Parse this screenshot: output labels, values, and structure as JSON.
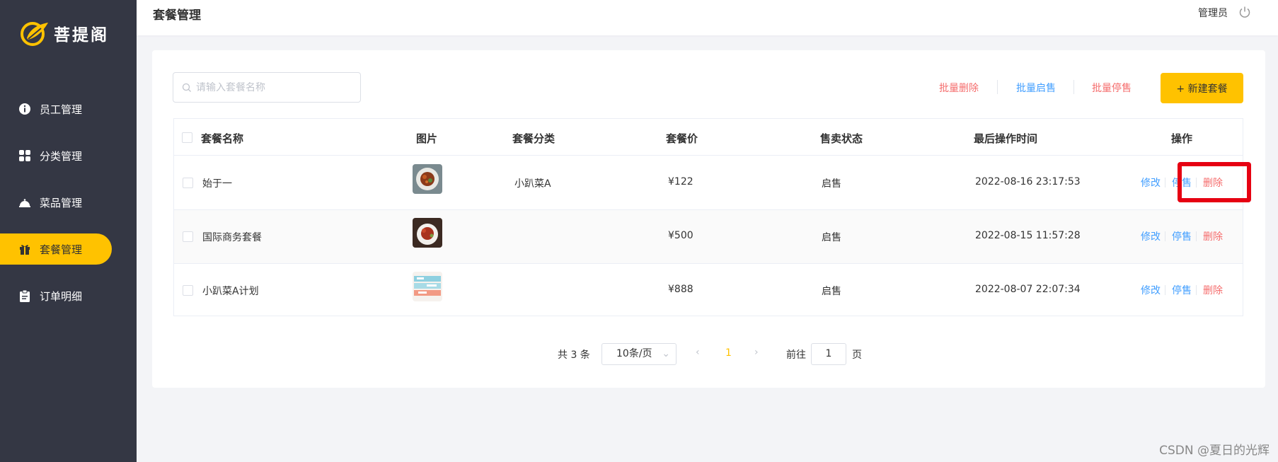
{
  "app": {
    "logo_text": "菩提阁"
  },
  "sidebar": {
    "items": [
      {
        "label": "员工管理",
        "icon": "info-icon"
      },
      {
        "label": "分类管理",
        "icon": "grid-icon"
      },
      {
        "label": "菜品管理",
        "icon": "dish-icon"
      },
      {
        "label": "套餐管理",
        "icon": "gift-icon",
        "active": true
      },
      {
        "label": "订单明细",
        "icon": "clipboard-icon"
      }
    ]
  },
  "header": {
    "title": "套餐管理",
    "user": "管理员",
    "power_icon": "power-icon"
  },
  "toolbar": {
    "search_placeholder": "请输入套餐名称",
    "batch_delete": "批量删除",
    "batch_enable": "批量启售",
    "batch_disable": "批量停售",
    "new_button": "+ 新建套餐"
  },
  "table": {
    "columns": [
      "套餐名称",
      "图片",
      "套餐分类",
      "套餐价",
      "售卖状态",
      "最后操作时间",
      "操作"
    ],
    "rows": [
      {
        "name": "始于一",
        "category": "小趴菜A",
        "price": "¥122",
        "status": "启售",
        "time": "2022-08-16 23:17:53"
      },
      {
        "name": "国际商务套餐",
        "category": "",
        "price": "¥500",
        "status": "启售",
        "time": "2022-08-15 11:57:28"
      },
      {
        "name": "小趴菜A计划",
        "category": "",
        "price": "¥888",
        "status": "启售",
        "time": "2022-08-07 22:07:34"
      }
    ],
    "actions": {
      "edit": "修改",
      "disable": "停售",
      "delete": "删除"
    }
  },
  "pagination": {
    "total": "共 3 条",
    "page_size": "10条/页",
    "current_page": "1",
    "goto_prefix": "前往",
    "goto_value": "1",
    "goto_suffix": "页"
  },
  "watermark": "CSDN @夏日的光辉",
  "colors": {
    "sidebar": "#343744",
    "accent": "#ffc200",
    "link": "#419eff",
    "danger": "#f56c6c",
    "highlight": "#e60012"
  }
}
